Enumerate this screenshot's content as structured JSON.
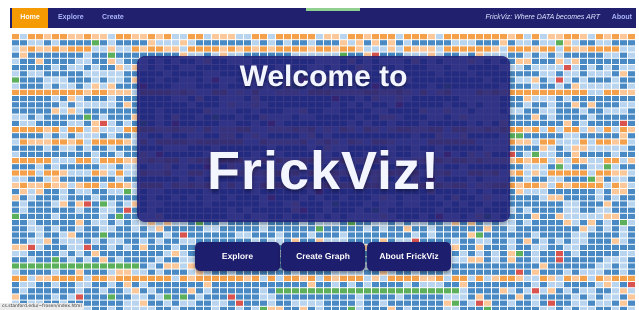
{
  "navbar": {
    "home_label": "Home",
    "explore_label": "Explore",
    "create_label": "Create",
    "tagline": "FrickViz: Where DATA becomes ART",
    "about_label": "About"
  },
  "hero": {
    "line1": "Welcome to",
    "line2": "FrickViz!"
  },
  "buttons": {
    "explore": "Explore",
    "create_graph": "Create Graph",
    "about": "About FrickViz"
  },
  "status_bar": {
    "url": "cs.stanford.edu/~frosen/index.html"
  },
  "colors": {
    "navbar_bg": "#20206f",
    "active_tab": "#f59a00",
    "hero_bg": "#1e1e78",
    "button_bg": "#1e1e6e",
    "tile_blue": "#4a8ac4",
    "tile_light_blue": "#b9d4ee",
    "tile_orange": "#f5a04a",
    "tile_peach": "#fcc89a",
    "tile_green": "#5cb05c",
    "tile_red": "#d9534f"
  }
}
